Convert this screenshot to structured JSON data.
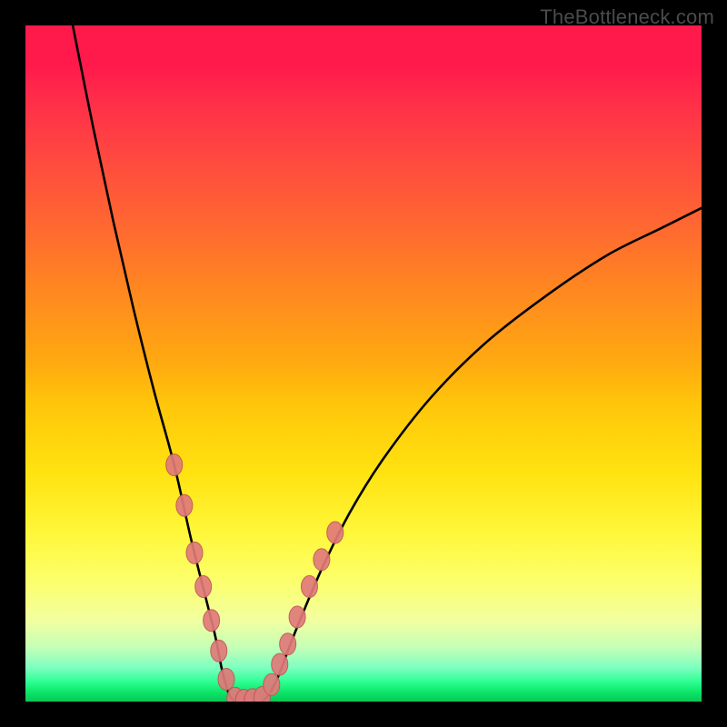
{
  "watermark_text": "TheBottleneck.com",
  "colors": {
    "frame": "#000000",
    "curve": "#000000",
    "marker_fill": "#e07a7a",
    "marker_stroke": "#c05555",
    "watermark": "#4b4b4b"
  },
  "chart_data": {
    "type": "line",
    "title": "",
    "xlabel": "",
    "ylabel": "",
    "xlim": [
      0,
      100
    ],
    "ylim": [
      0,
      100
    ],
    "note": "V-shaped bottleneck curve on a vertical heat gradient. y-axis encodes bottleneck percentage (0 at bottom = optimal; 100 at top = severe). x-axis is relative component rating. No numeric ticks shown.",
    "series": [
      {
        "name": "left-branch",
        "x": [
          7,
          10,
          13,
          16,
          19,
          22,
          24.5,
          26.5,
          28,
          29,
          29.7,
          30.3,
          31
        ],
        "y": [
          100,
          85,
          71,
          58,
          46,
          35,
          24,
          16,
          10,
          5,
          2.3,
          0.7,
          0
        ]
      },
      {
        "name": "valley",
        "x": [
          31,
          32,
          33,
          34,
          35
        ],
        "y": [
          0,
          0,
          0,
          0,
          0
        ]
      },
      {
        "name": "right-branch",
        "x": [
          35,
          36,
          37.5,
          39,
          41,
          44,
          48,
          53,
          60,
          68,
          77,
          86,
          94,
          100
        ],
        "y": [
          0,
          1,
          4,
          8,
          13,
          20,
          28,
          36,
          45,
          53,
          60,
          66,
          70,
          73
        ]
      }
    ],
    "markers": {
      "name": "highlighted-region",
      "points": [
        {
          "x": 22.0,
          "y": 35
        },
        {
          "x": 23.5,
          "y": 29
        },
        {
          "x": 25.0,
          "y": 22
        },
        {
          "x": 26.3,
          "y": 17
        },
        {
          "x": 27.5,
          "y": 12
        },
        {
          "x": 28.6,
          "y": 7.5
        },
        {
          "x": 29.7,
          "y": 3.3
        },
        {
          "x": 31.0,
          "y": 0.5
        },
        {
          "x": 32.3,
          "y": 0.2
        },
        {
          "x": 33.6,
          "y": 0.3
        },
        {
          "x": 35.0,
          "y": 0.6
        },
        {
          "x": 36.4,
          "y": 2.5
        },
        {
          "x": 37.6,
          "y": 5.5
        },
        {
          "x": 38.8,
          "y": 8.5
        },
        {
          "x": 40.2,
          "y": 12.5
        },
        {
          "x": 42.0,
          "y": 17
        },
        {
          "x": 43.8,
          "y": 21
        },
        {
          "x": 45.8,
          "y": 25
        }
      ]
    },
    "gradient_stops": [
      {
        "pct": 0,
        "color": "#ff1a4b"
      },
      {
        "pct": 20,
        "color": "#ff4a3f"
      },
      {
        "pct": 40,
        "color": "#ff8a1f"
      },
      {
        "pct": 60,
        "color": "#ffd60a"
      },
      {
        "pct": 80,
        "color": "#fbff60"
      },
      {
        "pct": 95,
        "color": "#7dffc0"
      },
      {
        "pct": 100,
        "color": "#07c755"
      }
    ]
  }
}
